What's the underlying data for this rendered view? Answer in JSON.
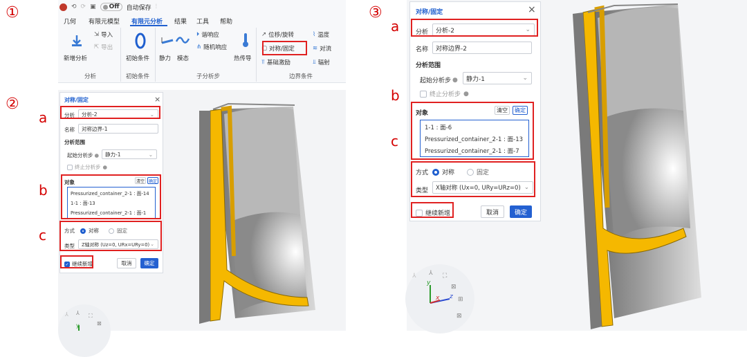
{
  "steps": {
    "s1": "①",
    "s2": "②",
    "s3": "③"
  },
  "ribbon": {
    "quick": {
      "toggle": "Off",
      "autosave": "自动保存"
    },
    "tabs": [
      "几何",
      "有限元模型",
      "有限元分析",
      "结果",
      "工具",
      "帮助"
    ],
    "items": {
      "new_analysis": "新增分析",
      "import": "导入",
      "export": "导出",
      "initial_cond": "初始条件",
      "static": "静力",
      "modal": "模态",
      "harmonic": "谐响应",
      "random": "随机响应",
      "heat": "热传导",
      "disp_rot": "位移/旋转",
      "sym_fixed": "对称/固定",
      "base_exc": "基础激励",
      "temperature": "温度",
      "convection": "对流",
      "radiation": "辐射"
    },
    "groups": {
      "analysis": "分析",
      "initial": "初始条件",
      "substep": "子分析步",
      "bc": "边界条件"
    }
  },
  "dialog2": {
    "title": "对称/固定",
    "analysis_label": "分析",
    "analysis_value": "分析-2",
    "name_label": "名称",
    "name_value": "对称边界-1",
    "range_title": "分析范围",
    "start_label": "起始分析步",
    "start_value": "静力-1",
    "stop_label": "终止分析步",
    "obj_label": "对象",
    "clear": "清空",
    "confirm_small": "确定",
    "objects": [
      "Pressurized_container_2-1 : 面-14",
      "1-1 : 面-13",
      "Pressurized_container_2-1 : 面-1"
    ],
    "mode_label": "方式",
    "mode_sym": "对称",
    "mode_fixed": "固定",
    "type_label": "类型",
    "type_value": "Z轴对称 (Uz=0, URx=URy=0)",
    "continue": "继续新增",
    "cancel": "取消",
    "ok": "确定"
  },
  "dialog3": {
    "title": "对称/固定",
    "analysis_label": "分析",
    "analysis_value": "分析-2",
    "name_label": "名称",
    "name_value": "对称边界-2",
    "range_title": "分析范围",
    "start_label": "起始分析步",
    "start_value": "静力-1",
    "stop_label": "终止分析步",
    "obj_label": "对象",
    "clear": "清空",
    "confirm_small": "确定",
    "objects": [
      "1-1 : 面-6",
      "Pressurized_container_2-1 : 面-13",
      "Pressurized_container_2-1 : 面-7"
    ],
    "mode_label": "方式",
    "mode_sym": "对称",
    "mode_fixed": "固定",
    "type_label": "类型",
    "type_value": "X轴对称 (Ux=0, URy=URz=0)",
    "continue": "继续新增",
    "cancel": "取消",
    "ok": "确定"
  },
  "markers": {
    "a": "a",
    "b": "b",
    "c": "c"
  },
  "axes": {
    "x": "x",
    "y": "y",
    "z": "z"
  },
  "colors": {
    "accent": "#1f5fcf",
    "highlight": "#e02020",
    "model_yellow": "#f5b800",
    "model_grey": "#9a9a9a"
  }
}
